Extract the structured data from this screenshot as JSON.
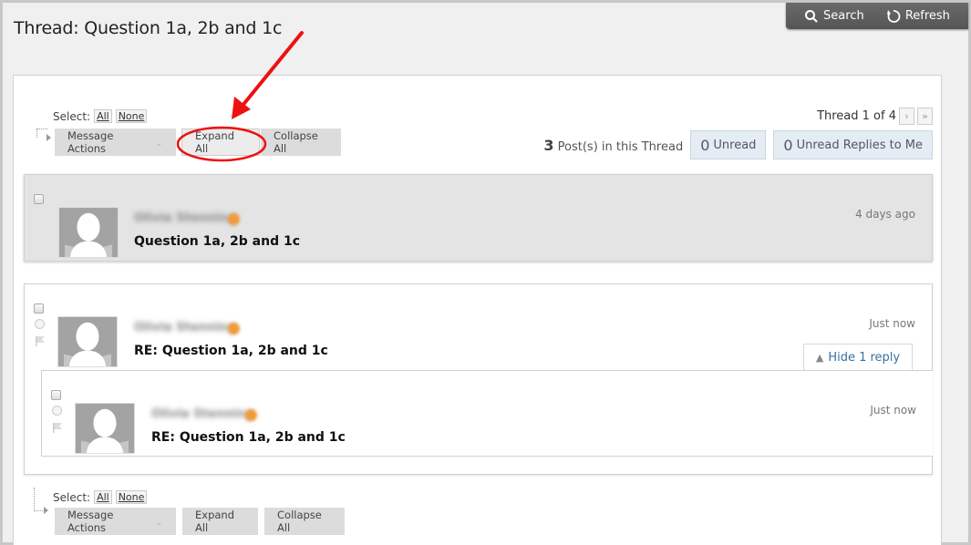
{
  "page": {
    "title": "Thread: Question 1a, 2b and 1c"
  },
  "top_toolbar": {
    "search_label": "Search",
    "refresh_label": "Refresh"
  },
  "top_controls": {
    "select_label": "Select:",
    "select_all": "All",
    "select_none": "None",
    "message_actions_label": "Message Actions",
    "expand_all_label": "Expand All",
    "collapse_all_label": "Collapse All"
  },
  "thread_nav": {
    "label": "Thread 1 of 4",
    "next_icon": "›",
    "last_icon": "»"
  },
  "stats": {
    "post_count": "3",
    "post_count_suffix": "Post(s) in this Thread",
    "unread_count": "0",
    "unread_label": "Unread",
    "unread_replies_count": "0",
    "unread_replies_label": "Unread Replies to Me"
  },
  "posts": [
    {
      "author": "Olivia Stenning",
      "subject": "Question 1a, 2b and 1c",
      "time": "4 days ago",
      "selected": true
    },
    {
      "author": "Olivia Stenning",
      "subject": "RE: Question 1a, 2b and 1c",
      "time": "Just now",
      "hide_reply_label": "Hide 1 reply"
    },
    {
      "author": "Olivia Stenning",
      "subject": "RE: Question 1a, 2b and 1c",
      "time": "Just now"
    }
  ],
  "bottom_controls": {
    "select_label": "Select:",
    "select_all": "All",
    "select_none": "None",
    "message_actions_label": "Message Actions",
    "expand_all_label": "Expand All",
    "collapse_all_label": "Collapse All"
  },
  "annotation": {
    "color": "#ee1111"
  }
}
